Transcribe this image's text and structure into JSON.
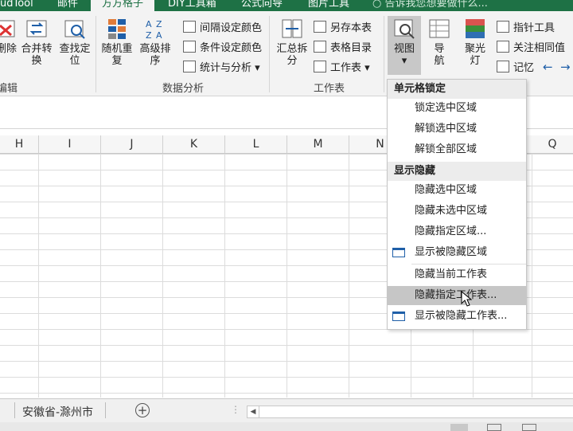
{
  "tabs": [
    {
      "label": "udTool"
    },
    {
      "label": "邮件"
    },
    {
      "label": "方方格子"
    },
    {
      "label": "DIY工具箱"
    },
    {
      "label": "公式向导"
    },
    {
      "label": "图片工具"
    }
  ],
  "tell_me": "告诉我您想要做什么...",
  "ribbon": {
    "group_edit": {
      "label": "编辑"
    },
    "g1": {
      "delete": "删除",
      "merge_convert": "合并转换",
      "find_locate": "查找定位"
    },
    "data_analysis": {
      "label": "数据分析",
      "random_dup": "随机重复",
      "adv_sort": "高级排序",
      "interval_color": "间隔设定颜色",
      "cond_color": "条件设定颜色",
      "stats": "统计与分析"
    },
    "worksheet": {
      "label": "工作表",
      "summary_split": "汇总拆分",
      "save_sheet": "另存本表",
      "table_dir": "表格目录",
      "worksheet_menu": "工作表"
    },
    "view": {
      "view": "视图",
      "nav": "导航",
      "spotlight": "聚光灯",
      "pointer_tool": "指针工具",
      "watch_same": "关注相同值",
      "memory": "记忆"
    }
  },
  "columns": [
    "H",
    "I",
    "J",
    "K",
    "L",
    "M",
    "N",
    "Q"
  ],
  "sheet_tab": "安徽省-滁州市",
  "dropdown": {
    "lock_header": "单元格锁定",
    "lock_items": [
      "锁定选中区域",
      "解锁选中区域",
      "解锁全部区域"
    ],
    "hide_header": "显示隐藏",
    "hide_items": [
      "隐藏选中区域",
      "隐藏未选中区域",
      "隐藏指定区域...",
      "显示被隐藏区域"
    ],
    "sheet_items": [
      "隐藏当前工作表",
      "隐藏指定工作表...",
      "显示被隐藏工作表..."
    ]
  }
}
